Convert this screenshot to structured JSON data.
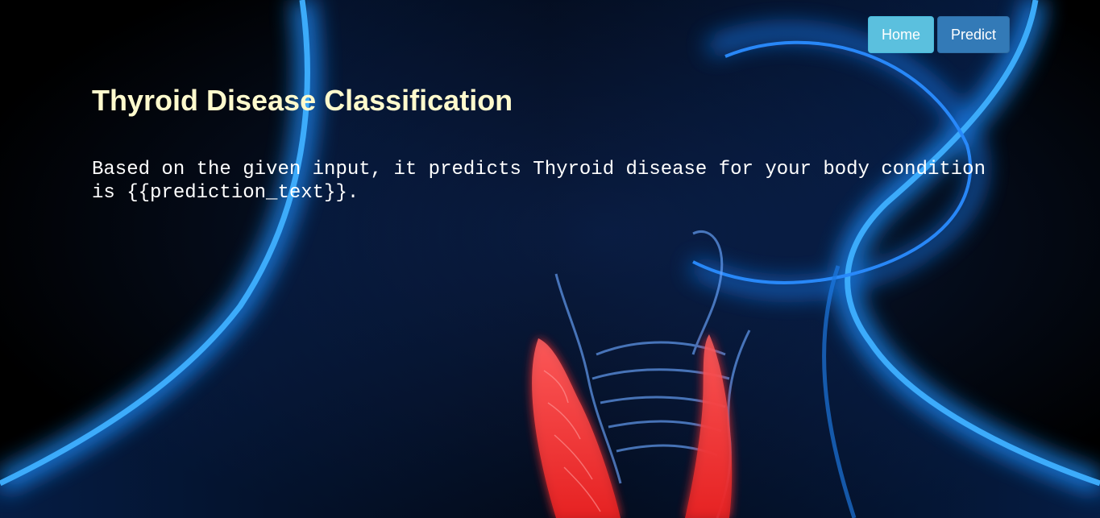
{
  "nav": {
    "home_label": "Home",
    "predict_label": "Predict"
  },
  "title": "Thyroid Disease Classification",
  "result_text": "Based on the given input, it predicts Thyroid disease for your body condition is {{prediction_text}}.",
  "colors": {
    "title": "#fffacd",
    "home_button": "#5bc0de",
    "predict_button": "#337ab7",
    "body_glow": "#1e90ff",
    "thyroid": "#ff3b3b"
  }
}
